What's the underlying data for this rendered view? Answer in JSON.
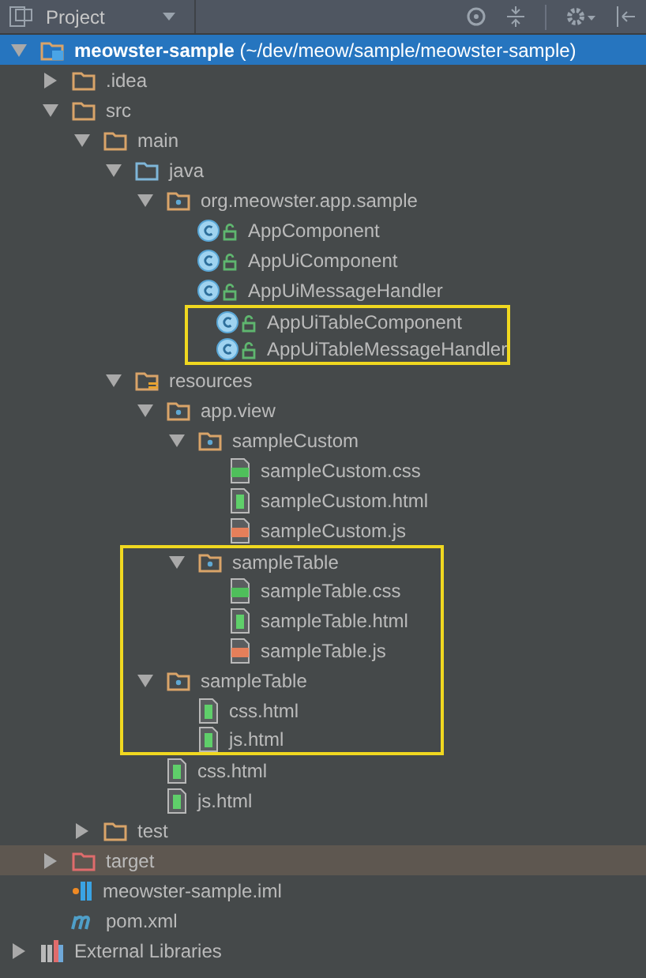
{
  "panel": {
    "title": "Project"
  },
  "tree": [
    {
      "label": "**meowster-sample** (~/dev/meow/sample/meowster-sample)",
      "kind": "module",
      "selected": true,
      "expanded": true,
      "boxed": false,
      "children": [
        {
          "label": ".idea",
          "kind": "folder",
          "selected": false,
          "expanded": false,
          "boxed": false
        },
        {
          "label": "src",
          "kind": "folder",
          "selected": false,
          "expanded": true,
          "boxed": false,
          "children": [
            {
              "label": "main",
              "kind": "folder",
              "selected": false,
              "expanded": true,
              "boxed": false,
              "children": [
                {
                  "label": "java",
                  "kind": "source-folder",
                  "selected": false,
                  "expanded": true,
                  "boxed": false,
                  "children": [
                    {
                      "label": "org.meowster.app.sample",
                      "kind": "package",
                      "selected": false,
                      "expanded": true,
                      "boxed": false,
                      "children": [
                        {
                          "label": "AppComponent",
                          "kind": "class",
                          "selected": false,
                          "boxed": false
                        },
                        {
                          "label": "AppUiComponent",
                          "kind": "class",
                          "selected": false,
                          "boxed": false
                        },
                        {
                          "label": "AppUiMessageHandler",
                          "kind": "class",
                          "selected": false,
                          "boxed": false
                        },
                        {
                          "label": "AppUiTableComponent",
                          "kind": "class",
                          "selected": false,
                          "boxed": true
                        },
                        {
                          "label": "AppUiTableMessageHandler",
                          "kind": "class",
                          "selected": false,
                          "boxed": true
                        }
                      ]
                    }
                  ]
                },
                {
                  "label": "resources",
                  "kind": "resources-folder",
                  "selected": false,
                  "expanded": true,
                  "boxed": false,
                  "children": [
                    {
                      "label": "app.view",
                      "kind": "package",
                      "selected": false,
                      "expanded": true,
                      "boxed": false,
                      "children": [
                        {
                          "label": "sampleCustom",
                          "kind": "package",
                          "selected": false,
                          "expanded": true,
                          "boxed": false,
                          "children": [
                            {
                              "label": "sampleCustom.css",
                              "kind": "css",
                              "selected": false,
                              "boxed": false
                            },
                            {
                              "label": "sampleCustom.html",
                              "kind": "html",
                              "selected": false,
                              "boxed": false
                            },
                            {
                              "label": "sampleCustom.js",
                              "kind": "js",
                              "selected": false,
                              "boxed": false
                            }
                          ]
                        },
                        {
                          "label": "sampleTable",
                          "kind": "package",
                          "selected": false,
                          "expanded": true,
                          "boxed": true,
                          "children": [
                            {
                              "label": "sampleTable.css",
                              "kind": "css",
                              "selected": false,
                              "boxed": true
                            },
                            {
                              "label": "sampleTable.html",
                              "kind": "html",
                              "selected": false,
                              "boxed": true
                            },
                            {
                              "label": "sampleTable.js",
                              "kind": "js",
                              "selected": false,
                              "boxed": true
                            }
                          ]
                        }
                      ]
                    },
                    {
                      "label": "sampleTable",
                      "kind": "package",
                      "selected": false,
                      "expanded": true,
                      "boxed": true,
                      "children": [
                        {
                          "label": "css.html",
                          "kind": "html",
                          "selected": false,
                          "boxed": true
                        },
                        {
                          "label": "js.html",
                          "kind": "html",
                          "selected": false,
                          "boxed": true
                        }
                      ]
                    },
                    {
                      "label": "css.html",
                      "kind": "html",
                      "selected": false,
                      "boxed": false
                    },
                    {
                      "label": "js.html",
                      "kind": "html",
                      "selected": false,
                      "boxed": false
                    }
                  ]
                }
              ]
            },
            {
              "label": "test",
              "kind": "folder",
              "selected": false,
              "expanded": false,
              "boxed": false
            }
          ]
        },
        {
          "label": "target",
          "kind": "excluded-folder",
          "selected": false,
          "expanded": false,
          "boxed": false
        },
        {
          "label": "meowster-sample.iml",
          "kind": "iml",
          "selected": false,
          "boxed": false
        },
        {
          "label": "pom.xml",
          "kind": "maven",
          "selected": false,
          "boxed": false
        }
      ]
    },
    {
      "label": "External Libraries",
      "kind": "libraries",
      "selected": false,
      "expanded": false,
      "boxed": false
    }
  ]
}
